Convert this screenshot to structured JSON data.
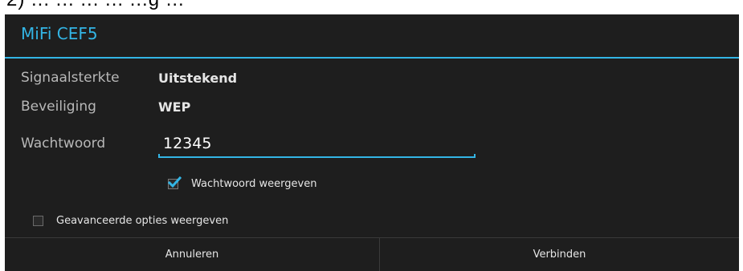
{
  "top_partial_text": "2) ... ... ... ... ...g ...",
  "dialog": {
    "title": "MiFi CEF5",
    "fields": {
      "signal": {
        "label": "Signaalsterkte",
        "value": "Uitstekend"
      },
      "security": {
        "label": "Beveiliging",
        "value": "WEP"
      },
      "password": {
        "label": "Wachtwoord",
        "value": "12345"
      }
    },
    "show_password": {
      "label": "Wachtwoord weergeven",
      "checked": true
    },
    "advanced_options": {
      "label": "Geavanceerde opties weergeven",
      "checked": false
    },
    "buttons": {
      "cancel": "Annuleren",
      "connect": "Verbinden"
    },
    "colors": {
      "accent": "#33b5e5",
      "background": "#1e1e1e",
      "label_text": "#b8b8b8",
      "value_text": "#e6e6e6"
    }
  }
}
